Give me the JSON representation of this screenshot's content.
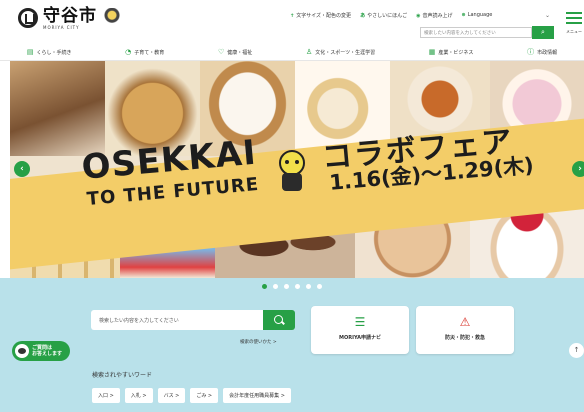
{
  "header": {
    "logo_text": "守谷市",
    "logo_sub": "MORIYA CITY",
    "util_links": [
      {
        "icon": "person-icon",
        "label": "文字サイズ・配色の変更"
      },
      {
        "icon": "text-icon",
        "label": "やさしいにほんご"
      },
      {
        "icon": "speaker-icon",
        "label": "音声読み上げ"
      },
      {
        "icon": "globe-icon",
        "label": "Language"
      }
    ],
    "search_placeholder": "検索したい内容を入力してください",
    "menu_label": "メニュー"
  },
  "nav": {
    "items": [
      {
        "icon": "book-icon",
        "label": "くらし・手続き"
      },
      {
        "icon": "child-icon",
        "label": "子育て・教育"
      },
      {
        "icon": "heart-icon",
        "label": "健康・福祉"
      },
      {
        "icon": "person-icon",
        "label": "文化・スポーツ・生涯学習"
      },
      {
        "icon": "building-icon",
        "label": "産業・ビジネス"
      },
      {
        "icon": "info-icon",
        "label": "市政情報"
      }
    ]
  },
  "hero": {
    "title_line1": "OSEKKAI",
    "title_line2": "TO THE FUTURE",
    "title_jp": "コラボフェア",
    "date_text": "1.16(金)〜1.29(木)",
    "slide_count": 6,
    "active_slide": 1
  },
  "search": {
    "placeholder": "検索したい内容を入力してください",
    "howto_label": "検索の使いかた >"
  },
  "cards": [
    {
      "icon": "checklist-icon",
      "label": "MORIYA申請ナビ",
      "color": "#27a046"
    },
    {
      "icon": "warning-icon",
      "label": "防災・防犯・救急",
      "color": "#d9342b"
    }
  ],
  "keywords": {
    "label": "検索されやすいワード",
    "items": [
      "入口 >",
      "入札 >",
      "バス >",
      "ごみ >",
      "会計年度任用職員募集 >"
    ]
  },
  "help_button": {
    "label_line1": "ご質問は",
    "label_line2": "お答えします"
  },
  "colors": {
    "accent": "#27a046",
    "banner": "#f3cd68",
    "panel": "#b9e1ea"
  }
}
